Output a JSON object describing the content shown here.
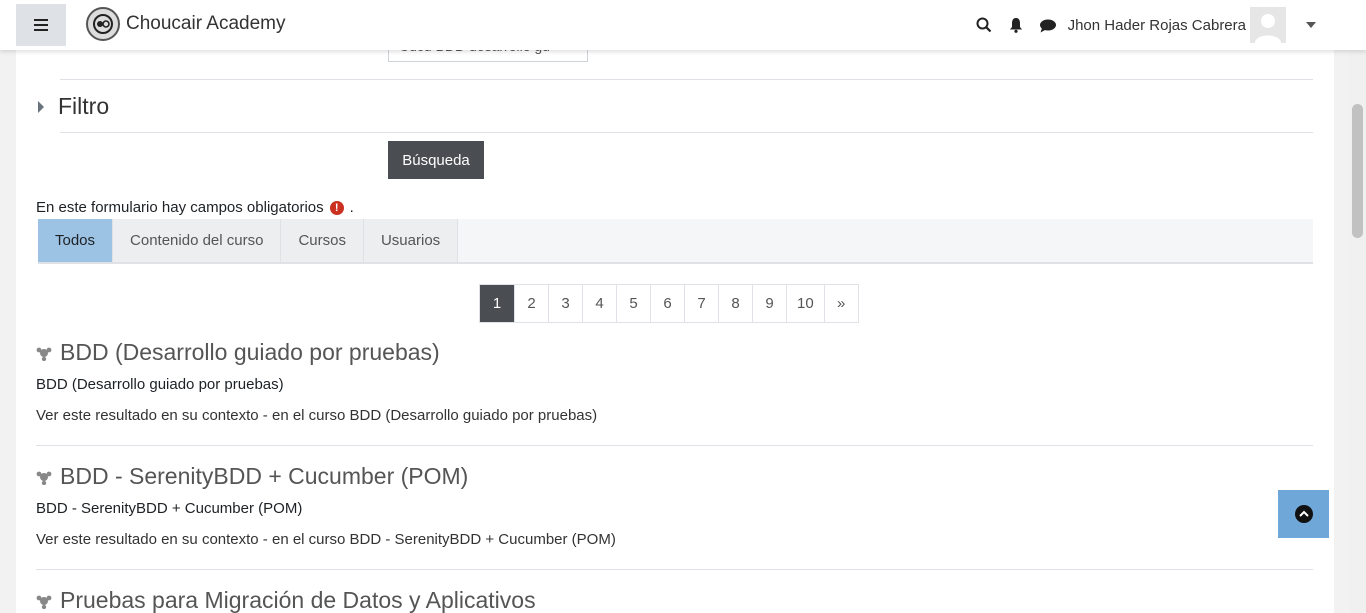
{
  "header": {
    "brand": "Choucair Academy",
    "user_name": "Jhon Hader Rojas Cabrera",
    "icons": [
      "menu-icon",
      "search-icon",
      "bell-icon",
      "chat-icon",
      "chevron-down-icon"
    ]
  },
  "form": {
    "prev_input_value": "Cucu BDD desarrollo gu",
    "filter_label": "Filtro",
    "search_button": "Búsqueda",
    "required_note": "En este formulario hay campos obligatorios",
    "required_note_suffix": "."
  },
  "tabs": [
    {
      "label": "Todos",
      "active": true
    },
    {
      "label": "Contenido del curso",
      "active": false
    },
    {
      "label": "Cursos",
      "active": false
    },
    {
      "label": "Usuarios",
      "active": false
    }
  ],
  "pagination": {
    "pages": [
      "1",
      "2",
      "3",
      "4",
      "5",
      "6",
      "7",
      "8",
      "9",
      "10"
    ],
    "current": "1",
    "next": "»"
  },
  "results": [
    {
      "title": "BDD (Desarrollo guiado por pruebas)",
      "description": "BDD (Desarrollo guiado por pruebas)",
      "context": "Ver este resultado en su contexto - en el curso BDD (Desarrollo guiado por pruebas)"
    },
    {
      "title": "BDD - SerenityBDD + Cucumber (POM)",
      "description": "BDD - SerenityBDD + Cucumber (POM)",
      "context": "Ver este resultado en su contexto - en el curso BDD - SerenityBDD + Cucumber (POM)"
    },
    {
      "title": "Pruebas para Migración de Datos y Aplicativos",
      "description": "",
      "context": ""
    }
  ],
  "colors": {
    "active_tab": "#9dc3e4",
    "dark_button": "#4a4d52",
    "required_icon": "#ca3120",
    "back_to_top": "#6fa8d8"
  }
}
